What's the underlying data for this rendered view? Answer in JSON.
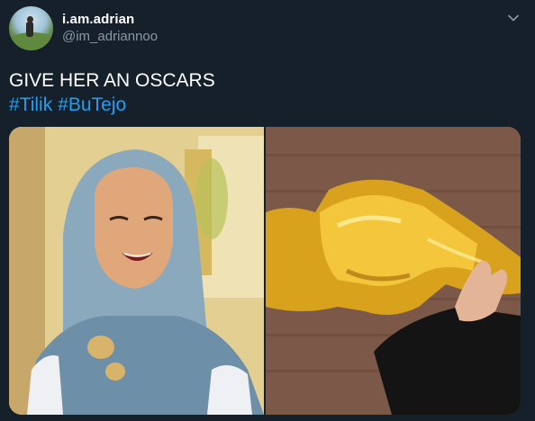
{
  "tweet": {
    "display_name": "i.am.adrian",
    "handle": "@im_adriannoo",
    "text": "GIVE HER AN OSCARS",
    "hashtags": [
      "#Tilik",
      "#BuTejo"
    ],
    "media": [
      {
        "icon": "hijab-woman-photo"
      },
      {
        "icon": "oscar-statuette-photo"
      }
    ]
  },
  "colors": {
    "background": "#15202b",
    "text": "#ffffff",
    "secondary_text": "#8899a6",
    "hashtag": "#1da1f2"
  }
}
